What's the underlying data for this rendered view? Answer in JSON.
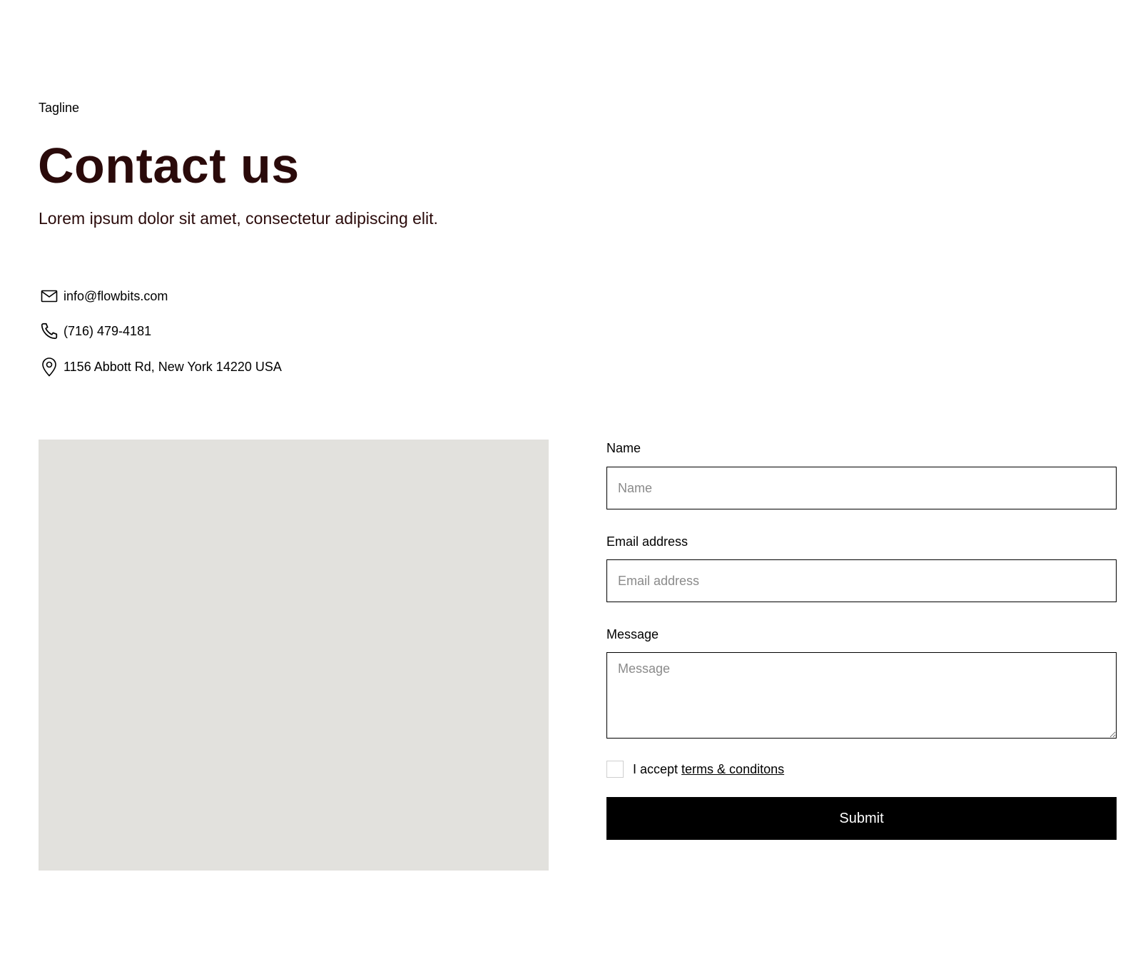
{
  "header": {
    "tagline": "Tagline",
    "title": "Contact us",
    "subtitle": "Lorem ipsum dolor sit amet, consectetur adipiscing elit."
  },
  "contact": {
    "email": {
      "icon": "mail-icon",
      "text": "info@flowbits.com"
    },
    "phone": {
      "icon": "phone-icon",
      "text": "(716) 479-4181"
    },
    "address": {
      "icon": "map-pin-icon",
      "text": "1156 Abbott Rd, New York 14220 USA"
    }
  },
  "form": {
    "name": {
      "label": "Name",
      "placeholder": "Name",
      "value": ""
    },
    "email": {
      "label": "Email address",
      "placeholder": "Email address",
      "value": ""
    },
    "message": {
      "label": "Message",
      "placeholder": "Message",
      "value": ""
    },
    "terms": {
      "prefix": "I accept ",
      "link_text": "terms & conditons",
      "checked": false
    },
    "submit_label": "Submit"
  },
  "colors": {
    "title_text": "#2a0a0a",
    "image_placeholder": "#e2e1dd",
    "button_bg": "#000000",
    "button_text": "#ffffff"
  }
}
